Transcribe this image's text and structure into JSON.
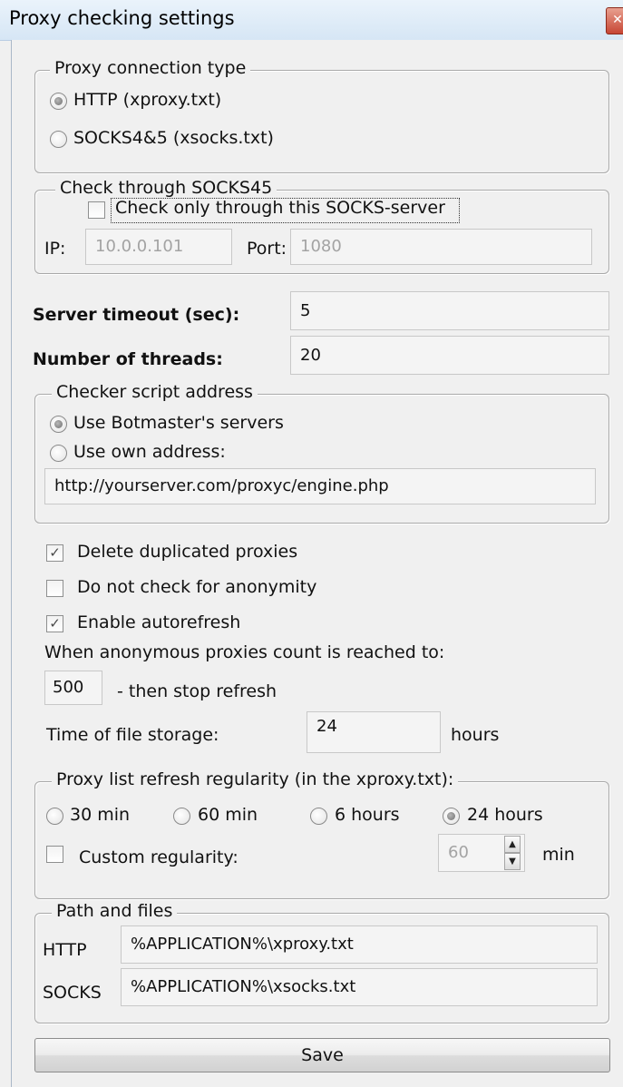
{
  "window": {
    "title": "Proxy checking settings",
    "close_glyph": "✕"
  },
  "connection_type": {
    "legend": "Proxy connection type",
    "options": [
      {
        "label": "HTTP (xproxy.txt)",
        "selected": true
      },
      {
        "label": "SOCKS4&5 (xsocks.txt)",
        "selected": false
      }
    ]
  },
  "socks_check": {
    "legend": "Check through SOCKS45",
    "checkbox_label": "Check only through this SOCKS-server",
    "checked": false,
    "ip_label": "IP:",
    "ip_value": "10.0.0.101",
    "port_label": "Port:",
    "port_value": "1080"
  },
  "server_timeout": {
    "label": "Server timeout (sec):",
    "value": "5"
  },
  "threads": {
    "label": "Number of threads:",
    "value": "20"
  },
  "checker_script": {
    "legend": "Checker script address",
    "options": [
      {
        "label": "Use Botmaster's servers",
        "selected": true
      },
      {
        "label": "Use own address:",
        "selected": false
      }
    ],
    "address_value": "http://yourserver.com/proxyc/engine.php"
  },
  "options": {
    "delete_duplicates": {
      "label": "Delete duplicated proxies",
      "checked": true
    },
    "no_anonymity_check": {
      "label": "Do not check for anonymity",
      "checked": false
    },
    "autorefresh": {
      "label": "Enable autorefresh",
      "checked": true
    },
    "anon_count_text": "When anonymous proxies count is reached to:",
    "anon_count_value": "500",
    "stop_refresh_text": "- then stop refresh",
    "storage_label": "Time of file storage:",
    "storage_value": "24",
    "storage_unit": "hours"
  },
  "refresh_regularity": {
    "legend": "Proxy list refresh regularity (in the xproxy.txt):",
    "options": [
      {
        "label": "30 min",
        "selected": false
      },
      {
        "label": "60 min",
        "selected": false
      },
      {
        "label": "6 hours",
        "selected": false
      },
      {
        "label": "24 hours",
        "selected": true
      }
    ],
    "custom_label": "Custom regularity:",
    "custom_checked": false,
    "custom_value": "60",
    "custom_unit": "min",
    "spin_up": "▲",
    "spin_down": "▼"
  },
  "paths": {
    "legend": "Path and files",
    "http_label": "HTTP",
    "http_value": "%APPLICATION%\\xproxy.txt",
    "socks_label": "SOCKS",
    "socks_value": "%APPLICATION%\\xsocks.txt"
  },
  "save_label": "Save",
  "check_glyph": "✓"
}
